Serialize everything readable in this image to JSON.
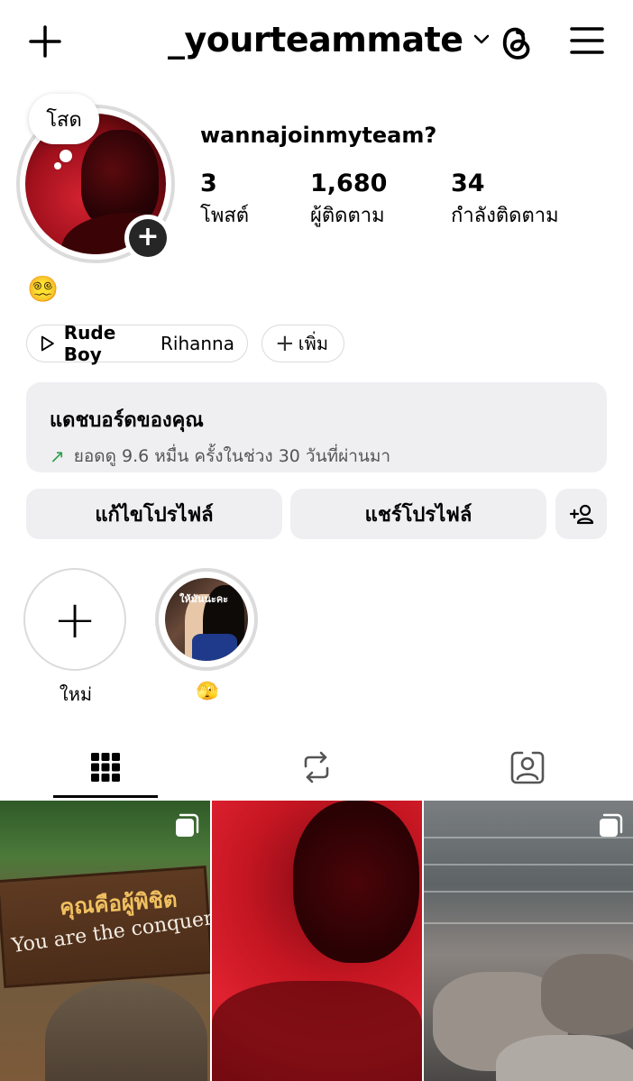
{
  "header": {
    "username": "_yourteammate",
    "icons": [
      "plus-icon",
      "chevron-down-icon",
      "threads-icon",
      "hamburger-menu-icon"
    ]
  },
  "profile": {
    "note_bubble": "โสด",
    "display_name": "wannajoinmyteam?",
    "stats": {
      "posts": {
        "value": "3",
        "label": "โพสต์"
      },
      "followers": {
        "value": "1,680",
        "label": "ผู้ติดตาม"
      },
      "following": {
        "value": "34",
        "label": "กำลังติดตาม"
      }
    },
    "bio_emoji": "😵‍💫"
  },
  "music": {
    "song": "Rude Boy",
    "artist": "Rihanna",
    "add_label": "เพิ่ม"
  },
  "dashboard": {
    "title": "แดชบอร์ดของคุณ",
    "subtitle": "ยอดดู 9.6 หมื่น ครั้งในช่วง 30 วันที่ผ่านมา",
    "trend_color": "#2e9e47"
  },
  "actions": {
    "edit_profile": "แก้ไขโปรไฟล์",
    "share_profile": "แชร์โปรไฟล์"
  },
  "highlights": [
    {
      "label": "ใหม่"
    },
    {
      "label": "🫣",
      "cover_text": "ให้มันนะคะ"
    }
  ],
  "tabs": [
    {
      "name": "posts-grid",
      "active": true
    },
    {
      "name": "reposts"
    },
    {
      "name": "tagged"
    }
  ],
  "posts": {
    "post1": {
      "sign_thai": "คุณคือผู้พิชิต",
      "sign_english": "You are the conqueror",
      "multi": true
    },
    "post2": {
      "multi": false
    },
    "post3": {
      "multi": true
    }
  }
}
